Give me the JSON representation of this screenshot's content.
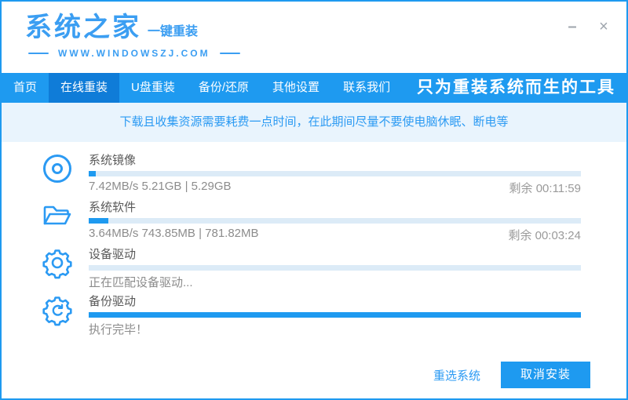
{
  "window": {
    "minimize_glyph": "–",
    "close_glyph": "×"
  },
  "header": {
    "brand": "系统之家",
    "brand_sub": "一键重装",
    "website": "WWW.WINDOWSZJ.COM"
  },
  "nav": {
    "tabs": [
      {
        "label": "首页"
      },
      {
        "label": "在线重装"
      },
      {
        "label": "U盘重装"
      },
      {
        "label": "备份/还原"
      },
      {
        "label": "其他设置"
      },
      {
        "label": "联系我们"
      }
    ],
    "active_tab": "在线重装",
    "slogan": "只为重装系统而生的工具"
  },
  "notice": {
    "text": "下载且收集资源需要耗费一点时间，在此期间尽量不要使电脑休眠、断电等"
  },
  "tasks": [
    {
      "icon": "disc-icon",
      "label": "系统镜像",
      "progress_pct": 1.5,
      "detail": "7.42MB/s 5.21GB | 5.29GB",
      "remaining": "剩余 00:11:59"
    },
    {
      "icon": "folder-open-icon",
      "label": "系统软件",
      "progress_pct": 4,
      "detail": "3.64MB/s 743.85MB | 781.82MB",
      "remaining": "剩余 00:03:24"
    },
    {
      "icon": "gear-icon",
      "label": "设备驱动",
      "progress_pct": 0,
      "detail": "正在匹配设备驱动...",
      "remaining": ""
    },
    {
      "icon": "gear-sync-icon",
      "label": "备份驱动",
      "progress_pct": 100,
      "detail": "执行完毕！",
      "remaining": ""
    }
  ],
  "footer": {
    "reselect_label": "重选系统",
    "cancel_label": "取消安装"
  },
  "colors": {
    "accent_blue": "#1e9af0",
    "active_tab_blue": "#0f7cd8",
    "notice_bg": "#e9f4fd",
    "notice_text": "#2b9af3",
    "bar_track": "#dcebf7",
    "brand_blue": "#3b9ef2"
  }
}
